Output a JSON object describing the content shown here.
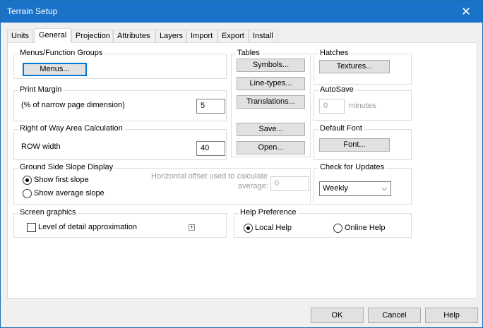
{
  "window": {
    "title": "Terrain Setup",
    "close_symbol": "✕"
  },
  "tabs": [
    {
      "label": "Units"
    },
    {
      "label": "General",
      "active": true
    },
    {
      "label": "Projection"
    },
    {
      "label": "Attributes"
    },
    {
      "label": "Layers"
    },
    {
      "label": "Import"
    },
    {
      "label": "Export"
    },
    {
      "label": "Install"
    }
  ],
  "menus_group": {
    "label": "Menus/Function Groups",
    "menus_button": "Menus..."
  },
  "print_margin": {
    "label": "Print Margin",
    "description": "(% of narrow page dimension)",
    "value": "5"
  },
  "row_area": {
    "label": "Right of Way Area Calculation",
    "row_width_label": "ROW width",
    "value": "40"
  },
  "ground_slope": {
    "label": "Ground Side Slope Display",
    "show_first": "Show first slope",
    "show_average": "Show average slope",
    "offset_label_1": "Horizontal offset used to calculate",
    "offset_label_2": "average:",
    "offset_value": "0"
  },
  "screen_graphics": {
    "label": "Screen graphics",
    "level_of_detail": "Level of detail approximation",
    "expand_symbol": "+"
  },
  "tables": {
    "label": "Tables",
    "symbols": "Symbols...",
    "line_types": "Line-types...",
    "translations": "Translations...",
    "save": "Save...",
    "open": "Open..."
  },
  "hatches": {
    "label": "Hatches",
    "textures": "Textures..."
  },
  "autosave": {
    "label": "AutoSave",
    "value": "0",
    "unit": "minutes"
  },
  "default_font": {
    "label": "Default Font",
    "font_button": "Font..."
  },
  "updates": {
    "label": "Check for Updates",
    "selected": "Weekly",
    "chevron": "⌵"
  },
  "help_pref": {
    "label": "Help Preference",
    "local": "Local Help",
    "online": "Online Help"
  },
  "footer": {
    "ok": "OK",
    "cancel": "Cancel",
    "help": "Help"
  }
}
